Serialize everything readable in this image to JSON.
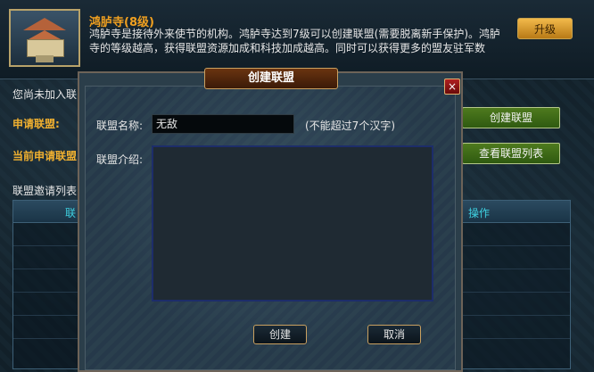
{
  "building": {
    "title": "鸿胪寺(8级)",
    "description": "鸿胪寺是接待外来使节的机构。鸿胪寺达到7级可以创建联盟(需要脱离新手保护)。鸿胪寺的等级越高，获得联盟资源加成和科技加成越高。同时可以获得更多的盟友驻军数",
    "upgrade_label": "升级"
  },
  "panel": {
    "status_text": "您尚未加入联",
    "apply_label": "申请联盟:",
    "current_apply_label": "当前申请联盟",
    "invite_list_label": "联盟邀请列表",
    "create_button": "创建联盟",
    "view_list_button": "查看联盟列表",
    "table_headers": [
      "联",
      "操作"
    ]
  },
  "modal": {
    "title": "创建联盟",
    "close_symbol": "×",
    "name_label": "联盟名称:",
    "name_value": "无敌",
    "name_hint": "(不能超过7个汉字)",
    "intro_label": "联盟介绍:",
    "intro_value": "",
    "confirm_button": "创建",
    "cancel_button": "取消"
  },
  "colors": {
    "accent_gold": "#f0b030",
    "header_cyan": "#3ed0e0",
    "button_green": "#4e7a1e"
  }
}
